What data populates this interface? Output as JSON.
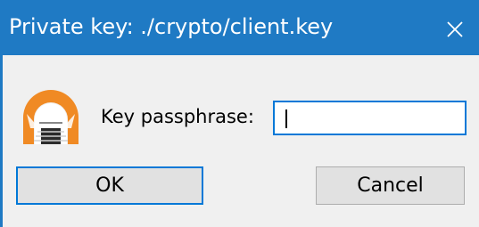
{
  "dialog": {
    "title": "Private key: ./crypto/client.key",
    "close_icon": "close-icon",
    "app_icon": "tunnel-icon",
    "prompt_label": "Key passphrase:",
    "passphrase_value": "",
    "ok_label": "OK",
    "cancel_label": "Cancel"
  },
  "colors": {
    "titlebar": "#1f7ac4",
    "focus_border": "#0078d7",
    "client_background": "#f0f0f0",
    "button_background": "#e1e1e1",
    "icon_orange": "#f08a24"
  }
}
